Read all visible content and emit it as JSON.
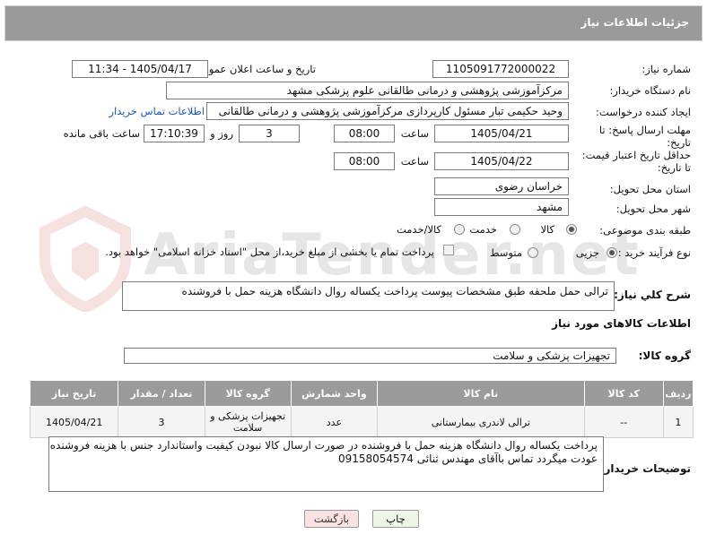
{
  "header": {
    "title": "جزئیات اطلاعات نیاز"
  },
  "form": {
    "need_number_label": "شماره نیاز:",
    "need_number": "1105091772000022",
    "announce_label": "تاریخ و ساعت اعلان عمومی:",
    "announce_value": "1405/04/17 - 11:34",
    "buyer_org_label": "نام دستگاه خریدار:",
    "buyer_org": "مرکزآموزشی  پژوهشی و درمانی طالقانی   علوم پزشکی مشهد",
    "creator_label": "ایجاد کننده درخواست:",
    "creator": "وحید حکیمی تبار مسئول کارپردازی مرکزآموزشی  پژوهشی و درمانی طالقانی",
    "contact_link": "اطلاعات تماس خریدار",
    "deadline_label_1": "مهلت ارسال پاسخ: تا",
    "deadline_label_2": "تاریخ:",
    "deadline_date": "1405/04/21",
    "time_label": "ساعت",
    "deadline_time": "08:00",
    "days_value": "3",
    "days_label": "روز و",
    "remaining_time": "17:10:39",
    "remaining_label": "ساعت باقی مانده",
    "validity_label_1": "حداقل تاریخ اعتبار قیمت:",
    "validity_label_2": "تا تاریخ:",
    "validity_date": "1405/04/22",
    "validity_time": "08:00",
    "province_label": "استان محل تحویل:",
    "province": "خراسان رضوی",
    "city_label": "شهر محل تحویل:",
    "city": "مشهد",
    "category_label": "طبقه بندی موضوعی:",
    "category_options": [
      "کالا",
      "خدمت",
      "کالا/خدمت"
    ],
    "category_selected": 0,
    "process_label": "نوع فرآیند خرید :",
    "process_options": [
      "جزیی",
      "متوسط"
    ],
    "process_selected": 0,
    "payment_note": "پرداخت تمام یا بخشی از مبلغ خرید،از محل \"اسناد خزانه اسلامی\" خواهد بود."
  },
  "description": {
    "label": "شرح کلي نياز:",
    "text": "ترالی حمل ملحفه  طبق مشخصات پیوست  پرداخت یکساله روال دانشگاه هزینه حمل با فروشنده"
  },
  "goods": {
    "section_title": "اطلاعات کالاهای مورد نیاز",
    "group_label": "گروه کالا:",
    "group_value": "تجهیزات پزشکی و سلامت",
    "columns": [
      "ردیف",
      "کد کالا",
      "نام کالا",
      "واحد شمارش",
      "گروه کالا",
      "تعداد / مقدار",
      "تاریخ نیاز"
    ],
    "rows": [
      {
        "row": "1",
        "code": "--",
        "name": "ترالی لاندری بیمارستانی",
        "unit": "عدد",
        "group_line1": "تجهیزات پزشکی و",
        "group_line2": "سلامت",
        "qty": "3",
        "date": "1405/04/21"
      }
    ]
  },
  "buyer_notes": {
    "label": "توضیحات خریدار:",
    "text": "پرداخت یکساله روال دانشگاه هزینه حمل با فروشنده در صورت ارسال کالا نبودن کیفیت واستاندارد جنس با هزینه فروشنده عودت میگردد تماس باآقای مهندس ثنائی 09158054574"
  },
  "buttons": {
    "print": "چاپ",
    "back": "بازگشت"
  },
  "watermark": {
    "text": "AriaTender.net"
  },
  "colors": {
    "header_bg": "#9a9a9a",
    "table_header_bg": "#9b9b9b",
    "link": "#1a56c0",
    "print_btn_bg": "#eef7e6",
    "back_btn_bg": "#fbe2e2"
  }
}
